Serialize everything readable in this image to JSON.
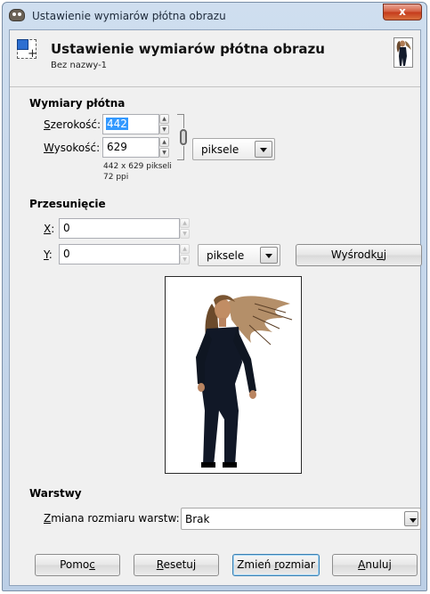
{
  "window": {
    "title": "Ustawienie wymiarów płótna obrazu",
    "close_label": "x"
  },
  "header": {
    "title": "Ustawienie wymiarów płótna obrazu",
    "subtitle": "Bez nazwy-1"
  },
  "canvas_size": {
    "section_title": "Wymiary płótna",
    "width_label_underlined": "S",
    "width_label_rest": "zerokość:",
    "width_value": "442",
    "height_label_underlined": "W",
    "height_label_rest": "ysokość:",
    "height_value": "629",
    "unit": "piksele",
    "size_info": "442 x 629 pikseli",
    "resolution_info": "72 ppi"
  },
  "offset": {
    "section_title": "Przesunięcie",
    "x_label_underlined": "X",
    "x_label_rest": ":",
    "x_value": "0",
    "y_label_underlined": "Y",
    "y_label_rest": ":",
    "y_value": "0",
    "unit": "piksele",
    "center_label_pre": "Wyśrodk",
    "center_label_underlined": "u",
    "center_label_post": "j"
  },
  "layers": {
    "section_title": "Warstwy",
    "resize_label_underlined": "Z",
    "resize_label_rest": "miana rozmiaru warstw:",
    "resize_value": "Brak"
  },
  "buttons": {
    "help_pre": "Pomo",
    "help_underlined": "c",
    "reset_underlined": "R",
    "reset_rest": "esetuj",
    "resize_pre": "Zmień ",
    "resize_underlined": "r",
    "resize_post": "ozmiar",
    "cancel_underlined": "A",
    "cancel_rest": "nuluj"
  },
  "colors": {
    "selection": "#3399ff",
    "dialog_bg": "#f0f0f0",
    "title_bar": "#cfdeef",
    "close_button": "#c5391a"
  }
}
